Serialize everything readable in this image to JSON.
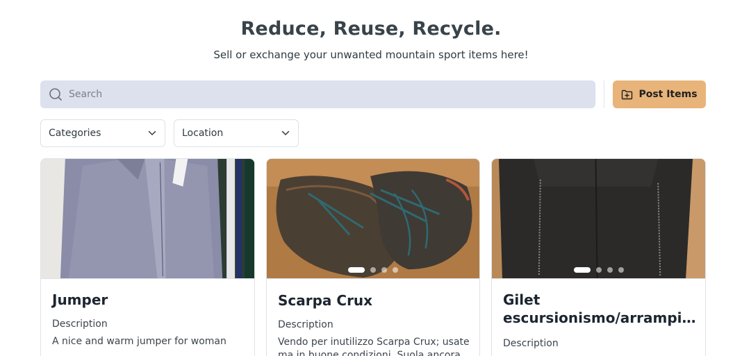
{
  "hero": {
    "title": "Reduce, Reuse, Recycle.",
    "subtitle": "Sell or exchange your unwanted mountain sport items here!"
  },
  "search": {
    "placeholder": "Search",
    "icon": "search-icon"
  },
  "post_button": {
    "label": "Post Items",
    "icon": "folder-plus-icon",
    "color": "#e8b47a"
  },
  "filters": {
    "categories_label": "Categories",
    "location_label": "Location"
  },
  "items": [
    {
      "title": "Jumper",
      "desc_label": "Description",
      "description": "A nice and warm jumper for woman",
      "image": "grey knit jumper photo",
      "image_count": 1
    },
    {
      "title": "Scarpa Crux",
      "desc_label": "Description",
      "description": "Vendo per inutilizzo Scarpa Crux; usate ma in buone condizioni. Suola ancora",
      "image": "brown approach shoes photo",
      "image_count": 4,
      "active_image": 1
    },
    {
      "title": "Gilet escursionismo/arrampic...",
      "title_line1": "Gilet",
      "title_line2": "escursionismo/arrampic...",
      "desc_label": "Description",
      "image": "black vest photo",
      "image_count": 4,
      "active_image": 1
    }
  ]
}
